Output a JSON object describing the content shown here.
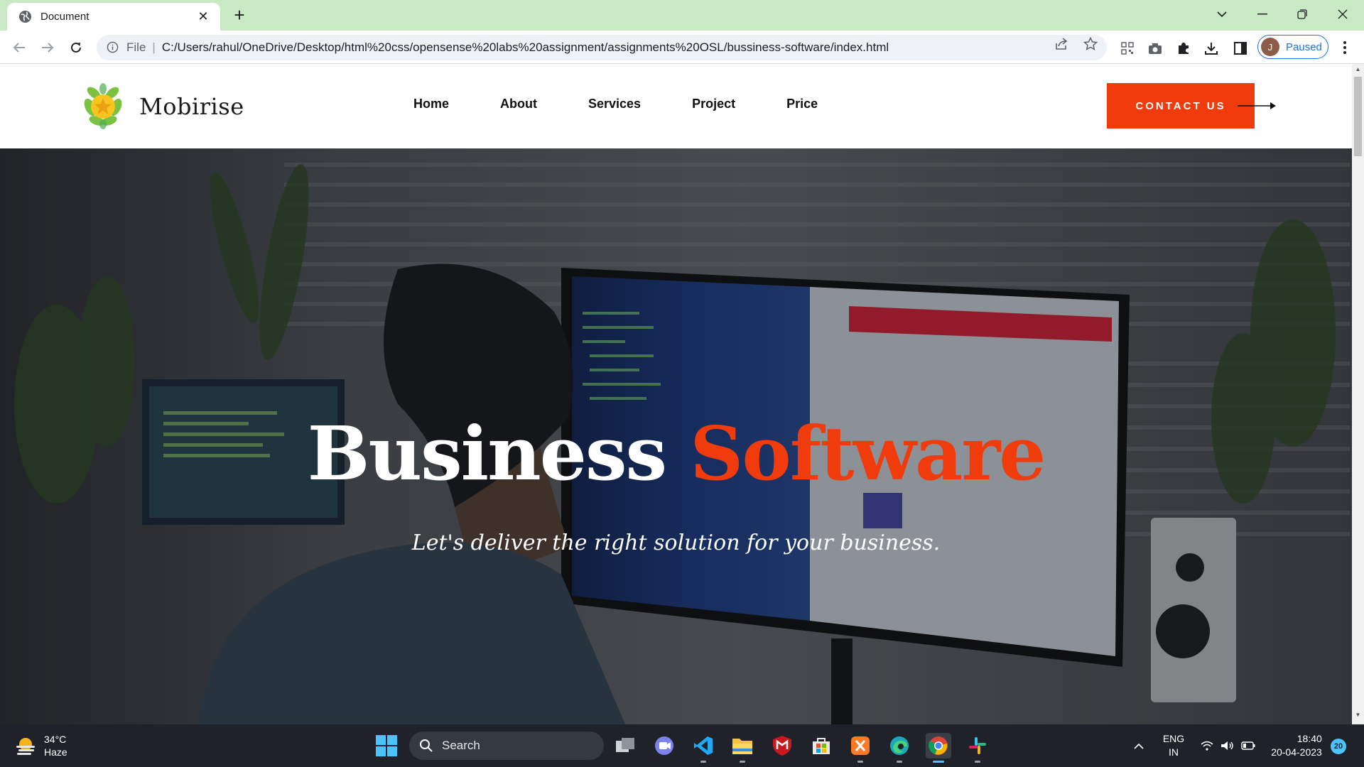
{
  "browser": {
    "tab_title": "Document",
    "address_protocol": "File",
    "address_url": "C:/Users/rahul/OneDrive/Desktop/html%20css/opensense%20labs%20assignment/assignments%20OSL/bussiness-software/index.html",
    "profile_initial": "J",
    "profile_status": "Paused"
  },
  "site": {
    "brand": "Mobirise",
    "nav": [
      "Home",
      "About",
      "Services",
      "Project",
      "Price"
    ],
    "cta_label": "CONTACT US",
    "hero": {
      "title_part1": "Business",
      "title_part2": "Software",
      "subtitle": "Let's deliver the right solution for your business."
    },
    "colors": {
      "accent": "#f03c0c",
      "header_bg": "#ffffff"
    }
  },
  "taskbar": {
    "weather_temp": "34°C",
    "weather_desc": "Haze",
    "search_label": "Search",
    "lang_line1": "ENG",
    "lang_line2": "IN",
    "time": "18:40",
    "date": "20-04-2023",
    "notification_count": "20"
  }
}
